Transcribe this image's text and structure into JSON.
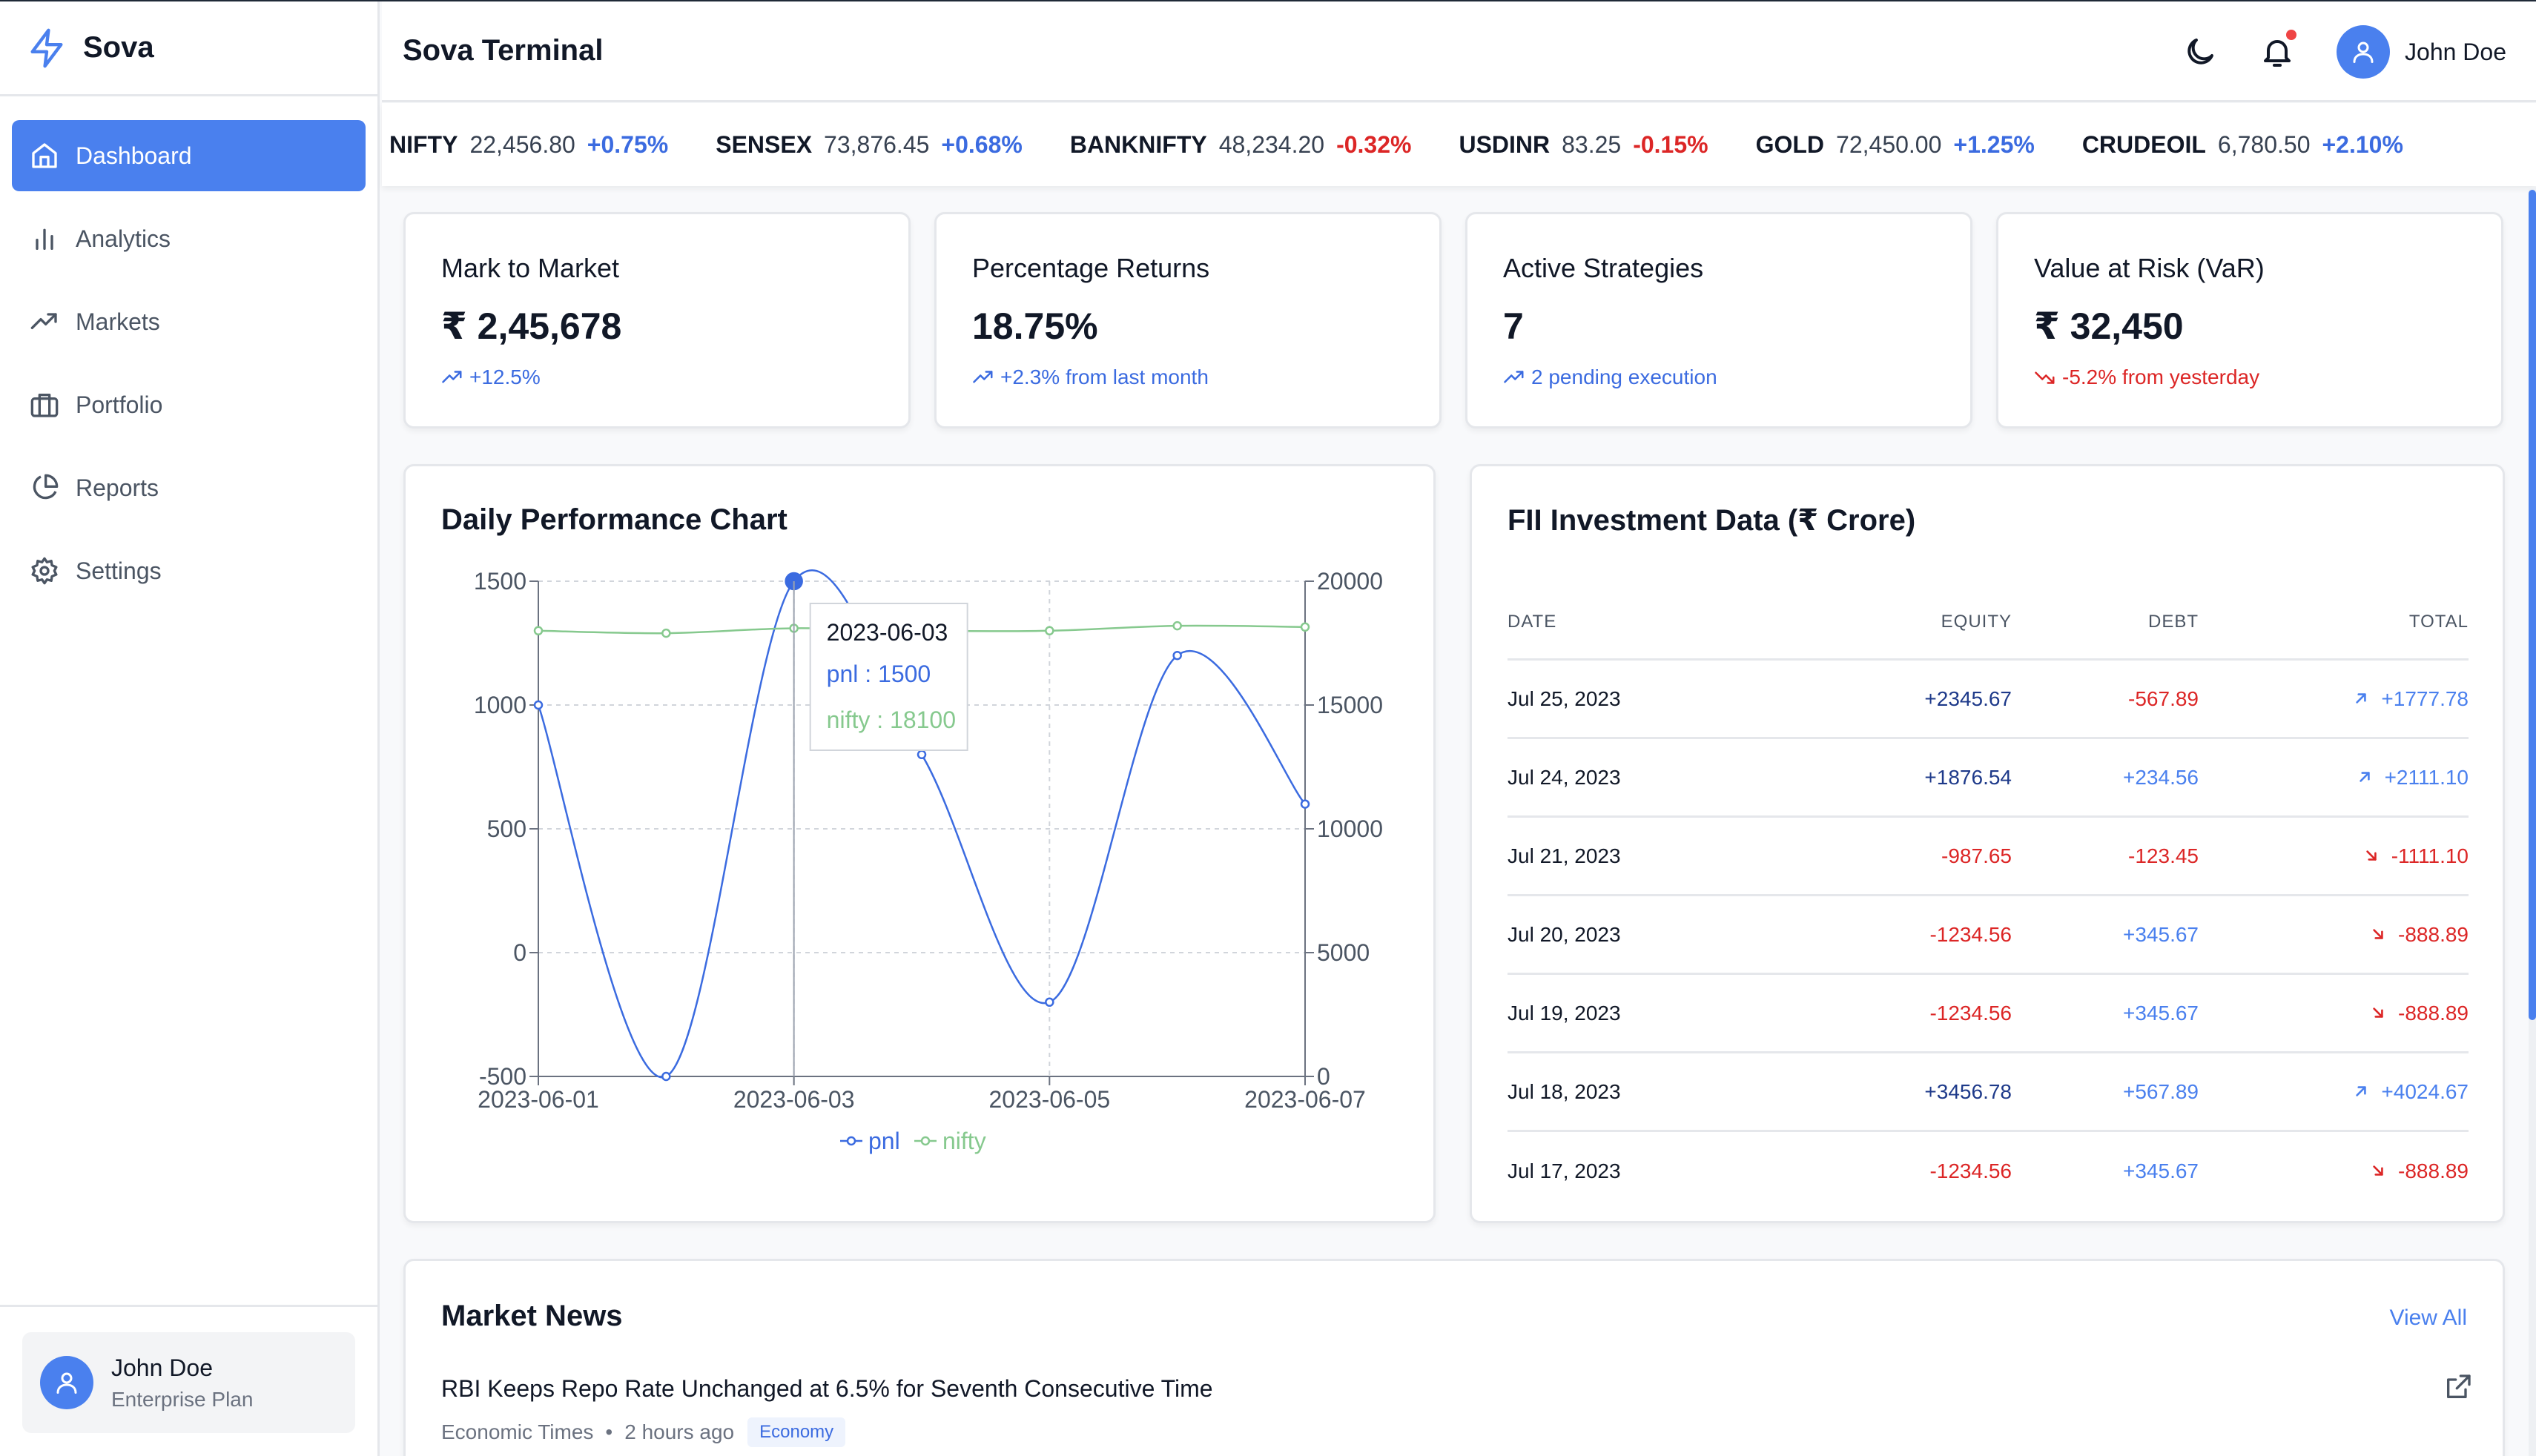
{
  "app": {
    "brand": "Sova",
    "title": "Sova Terminal"
  },
  "sidebar": {
    "items": [
      {
        "label": "Dashboard",
        "icon": "home-icon",
        "active": true
      },
      {
        "label": "Analytics",
        "icon": "bar-chart-icon"
      },
      {
        "label": "Markets",
        "icon": "trending-up-icon"
      },
      {
        "label": "Portfolio",
        "icon": "briefcase-icon"
      },
      {
        "label": "Reports",
        "icon": "pie-chart-icon"
      },
      {
        "label": "Settings",
        "icon": "gear-icon"
      }
    ],
    "user": {
      "name": "John Doe",
      "plan": "Enterprise Plan"
    }
  },
  "header": {
    "user_name": "John Doe"
  },
  "ticker": [
    {
      "symbol": "NIFTY",
      "price": "22,456.80",
      "change": "+0.75%",
      "dir": "pos"
    },
    {
      "symbol": "SENSEX",
      "price": "73,876.45",
      "change": "+0.68%",
      "dir": "pos"
    },
    {
      "symbol": "BANKNIFTY",
      "price": "48,234.20",
      "change": "-0.32%",
      "dir": "neg"
    },
    {
      "symbol": "USDINR",
      "price": "83.25",
      "change": "-0.15%",
      "dir": "neg"
    },
    {
      "symbol": "GOLD",
      "price": "72,450.00",
      "change": "+1.25%",
      "dir": "pos"
    },
    {
      "symbol": "CRUDEOIL",
      "price": "6,780.50",
      "change": "+2.10%",
      "dir": "pos"
    }
  ],
  "stats": [
    {
      "label": "Mark to Market",
      "value": "₹ 2,45,678",
      "sub": "+12.5%",
      "dir": "pos"
    },
    {
      "label": "Percentage Returns",
      "value": "18.75%",
      "sub": "+2.3% from last month",
      "dir": "pos"
    },
    {
      "label": "Active Strategies",
      "value": "7",
      "sub": "2 pending execution",
      "dir": "pos"
    },
    {
      "label": "Value at Risk (VaR)",
      "value": "₹ 32,450",
      "sub": "-5.2% from yesterday",
      "dir": "neg"
    }
  ],
  "chart_card": {
    "title": "Daily Performance Chart"
  },
  "chart_data": {
    "type": "line",
    "x": [
      "2023-06-01",
      "2023-06-02",
      "2023-06-03",
      "2023-06-04",
      "2023-06-05",
      "2023-06-06",
      "2023-06-07"
    ],
    "x_tick_labels": [
      "2023-06-01",
      "2023-06-03",
      "2023-06-05",
      "2023-06-07"
    ],
    "series": [
      {
        "name": "pnl",
        "axis": "left",
        "color": "#3b6be0",
        "values": [
          1000,
          -500,
          1500,
          800,
          -200,
          1200,
          600
        ]
      },
      {
        "name": "nifty",
        "axis": "right",
        "color": "#86c98e",
        "values": [
          18000,
          17900,
          18100,
          18000,
          18000,
          18200,
          18150
        ]
      }
    ],
    "y_left": {
      "range": [
        -500,
        1500
      ],
      "ticks": [
        -500,
        0,
        500,
        1000,
        1500
      ]
    },
    "y_right": {
      "range": [
        0,
        20000
      ],
      "ticks": [
        0,
        5000,
        10000,
        15000,
        20000
      ]
    },
    "legend": "bottom-center",
    "tooltip": {
      "date": "2023-06-03",
      "pnl_label": "pnl : 1500",
      "nifty_label": "nifty : 18100"
    }
  },
  "fii": {
    "title": "FII Investment Data (₹ Crore)",
    "headers": {
      "date": "DATE",
      "equity": "EQUITY",
      "debt": "DEBT",
      "total": "TOTAL"
    },
    "rows": [
      {
        "date": "Jul 25, 2023",
        "equity": "+2345.67",
        "debt": "-567.89",
        "total": "+1777.78"
      },
      {
        "date": "Jul 24, 2023",
        "equity": "+1876.54",
        "debt": "+234.56",
        "total": "+2111.10"
      },
      {
        "date": "Jul 21, 2023",
        "equity": "-987.65",
        "debt": "-123.45",
        "total": "-1111.10"
      },
      {
        "date": "Jul 20, 2023",
        "equity": "-1234.56",
        "debt": "+345.67",
        "total": "-888.89"
      },
      {
        "date": "Jul 19, 2023",
        "equity": "-1234.56",
        "debt": "+345.67",
        "total": "-888.89"
      },
      {
        "date": "Jul 18, 2023",
        "equity": "+3456.78",
        "debt": "+567.89",
        "total": "+4024.67"
      },
      {
        "date": "Jul 17, 2023",
        "equity": "-1234.56",
        "debt": "+345.67",
        "total": "-888.89"
      }
    ]
  },
  "news": {
    "title": "Market News",
    "view_all": "View All",
    "items": [
      {
        "headline": "RBI Keeps Repo Rate Unchanged at 6.5% for Seventh Consecutive Time",
        "source": "Economic Times",
        "time": "2 hours ago",
        "tag": "Economy"
      }
    ]
  },
  "colors": {
    "accent": "#4a80ee",
    "positive": "#3b6be0",
    "negative": "#dc2626",
    "nifty": "#86c98e"
  }
}
